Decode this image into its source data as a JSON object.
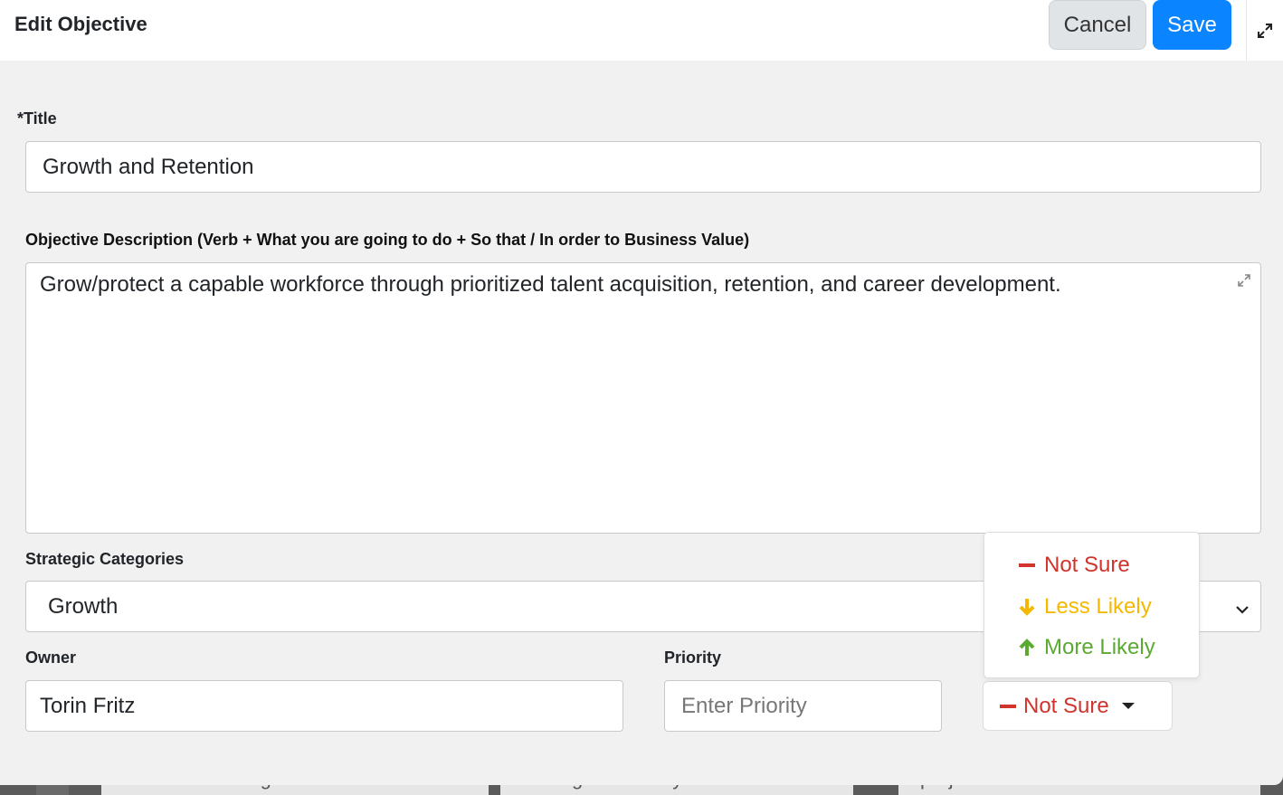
{
  "modal": {
    "title": "Edit Objective",
    "cancel_label": "Cancel",
    "save_label": "Save"
  },
  "form": {
    "title_label": "*Title",
    "title_value": "Growth and Retention",
    "description_label": "Objective Description (Verb + What you are going to do + So that / In order to Business Value)",
    "description_value": "Grow/protect a capable workforce through prioritized talent acquisition, retention, and career development.",
    "categories_label": "Strategic Categories",
    "categories_value": "Growth",
    "owner_label": "Owner",
    "owner_value": "Torin Fritz",
    "priority_label": "Priority",
    "priority_placeholder": "Enter Priority",
    "confidence_value": "Not Sure"
  },
  "confidence_dropdown": {
    "items": [
      {
        "label": "Not Sure",
        "icon": "dash-icon",
        "color": "#d0342c"
      },
      {
        "label": "Less Likely",
        "icon": "arrow-down-icon",
        "color": "#f5b800"
      },
      {
        "label": "More Likely",
        "icon": "arrow-up-icon",
        "color": "#5aaa32"
      }
    ]
  },
  "background_cards": {
    "card1": "workforce through",
    "card2": "Management Playbook",
    "card3": "project technical debt to"
  },
  "colors": {
    "accent": "#0a84ff",
    "not_sure": "#d0342c",
    "less_likely": "#f5b800",
    "more_likely": "#5aaa32"
  }
}
